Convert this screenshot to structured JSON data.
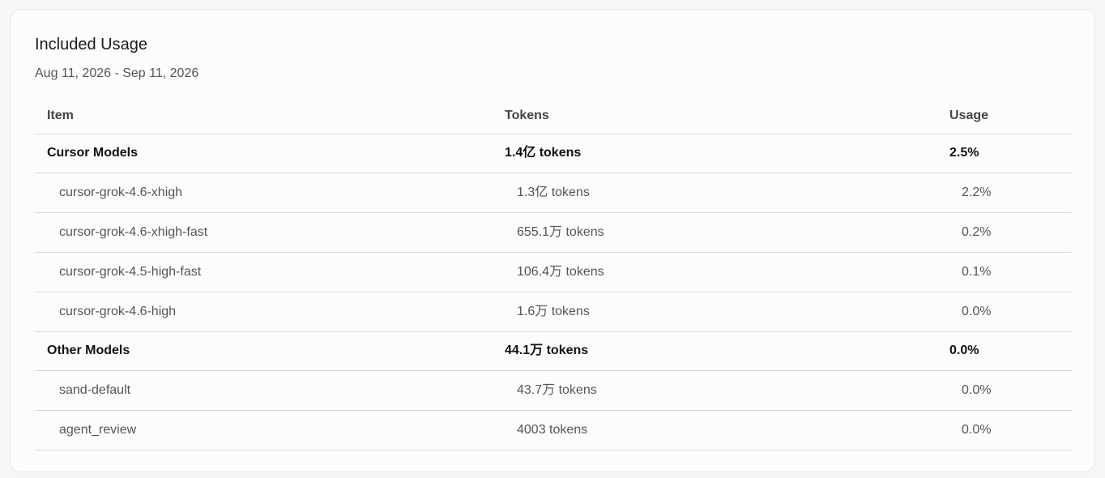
{
  "card": {
    "title": "Included Usage",
    "date_range": "Aug 11, 2026 - Sep 11, 2026"
  },
  "table": {
    "headers": {
      "item": "Item",
      "tokens": "Tokens",
      "usage": "Usage"
    },
    "groups": [
      {
        "name": "Cursor Models",
        "tokens": "1.4亿 tokens",
        "usage": "2.5%",
        "rows": [
          {
            "name": "cursor-grok-4.6-xhigh",
            "tokens": "1.3亿 tokens",
            "usage": "2.2%"
          },
          {
            "name": "cursor-grok-4.6-xhigh-fast",
            "tokens": "655.1万 tokens",
            "usage": "0.2%"
          },
          {
            "name": "cursor-grok-4.5-high-fast",
            "tokens": "106.4万 tokens",
            "usage": "0.1%"
          },
          {
            "name": "cursor-grok-4.6-high",
            "tokens": "1.6万 tokens",
            "usage": "0.0%"
          }
        ]
      },
      {
        "name": "Other Models",
        "tokens": "44.1万 tokens",
        "usage": "0.0%",
        "rows": [
          {
            "name": "sand-default",
            "tokens": "43.7万 tokens",
            "usage": "0.0%"
          },
          {
            "name": "agent_review",
            "tokens": "4003 tokens",
            "usage": "0.0%"
          }
        ]
      }
    ]
  }
}
